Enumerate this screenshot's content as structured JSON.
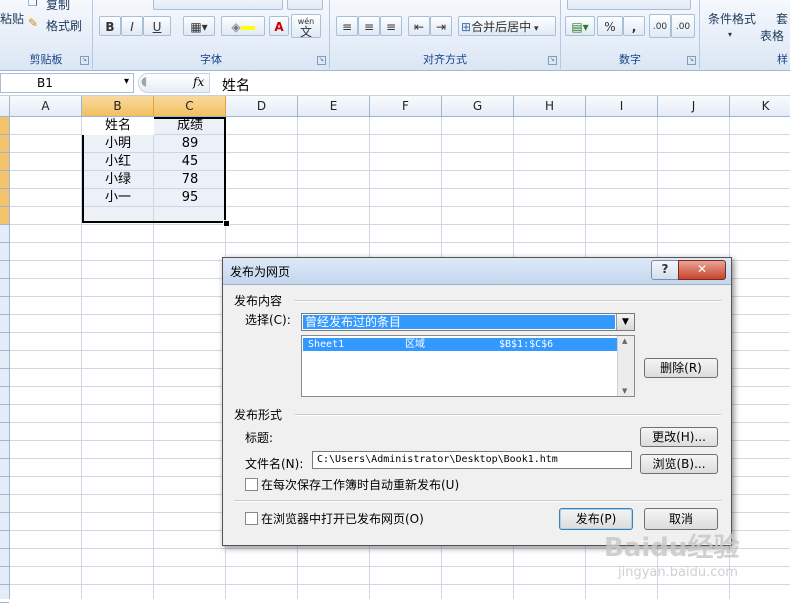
{
  "ribbon": {
    "clipboard": {
      "paste_label": "粘贴",
      "copy_label": "复制",
      "format_painter_label": "格式刷",
      "group_label": "剪贴板"
    },
    "font": {
      "bold": "B",
      "italic": "I",
      "underline": "U",
      "wen": "wén",
      "wen_char": "文",
      "group_label": "字体"
    },
    "alignment": {
      "merge_label": "合并后居中",
      "group_label": "对齐方式"
    },
    "number": {
      "percent": "%",
      "comma": ",",
      "inc_decimal": ".00",
      "dec_decimal": ".00",
      "group_label": "数字"
    },
    "styles": {
      "conditional_label": "条件格式",
      "table_label_1": "套",
      "table_label_2": "表格",
      "group_label": "样"
    }
  },
  "formula_bar": {
    "name_box": "B1",
    "fx": "fx",
    "content": "姓名"
  },
  "columns": [
    "A",
    "B",
    "C",
    "D",
    "E",
    "F",
    "G",
    "H",
    "I",
    "J",
    "K"
  ],
  "sheet": {
    "headers": [
      "姓名",
      "成绩"
    ],
    "rows": [
      {
        "name": "小明",
        "score": "89"
      },
      {
        "name": "小红",
        "score": "45"
      },
      {
        "name": "小绿",
        "score": "78"
      },
      {
        "name": "小一",
        "score": "95"
      }
    ]
  },
  "dialog": {
    "title": "发布为网页",
    "help": "?",
    "close": "✕",
    "publish_content": "发布内容",
    "select_label": "选择(C):",
    "select_value": "曾经发布过的条目",
    "list_item": {
      "sheet": "Sheet1",
      "kind": "区域",
      "range": "$B$1:$C$6"
    },
    "delete_button": "删除(R)",
    "publish_format": "发布形式",
    "title_label": "标题:",
    "change_button": "更改(H)...",
    "filename_label": "文件名(N):",
    "filename_value": "C:\\Users\\Administrator\\Desktop\\Book1.htm",
    "browse_button": "浏览(B)...",
    "autorepublish_label": "在每次保存工作簿时自动重新发布(U)",
    "open_browser_label": "在浏览器中打开已发布网页(O)",
    "publish_button": "发布(P)",
    "cancel_button": "取消"
  },
  "watermark": {
    "brand": "Baidu经验",
    "url": "jingyan.baidu.com"
  }
}
